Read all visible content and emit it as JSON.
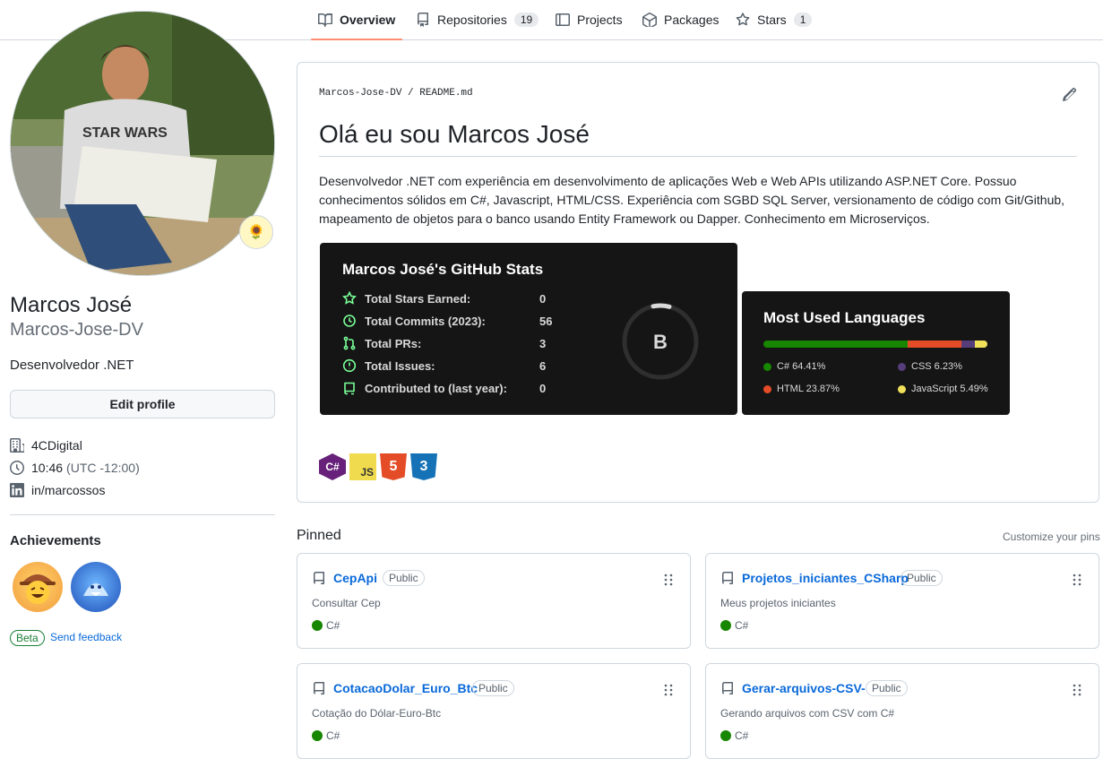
{
  "tabs": [
    {
      "label": "Overview",
      "count": ""
    },
    {
      "label": "Repositories",
      "count": "19"
    },
    {
      "label": "Projects",
      "count": ""
    },
    {
      "label": "Packages",
      "count": ""
    },
    {
      "label": "Stars",
      "count": "1"
    }
  ],
  "profile": {
    "status_emoji": "🌻",
    "fullname": "Marcos José",
    "login": "Marcos-Jose-DV",
    "bio": "Desenvolvedor .NET",
    "edit_label": "Edit profile",
    "company": "4CDigital",
    "time": "10:46",
    "timezone": "(UTC -12:00)",
    "linkedin": "in/marcossos"
  },
  "achievements": {
    "title": "Achievements",
    "beta": "Beta",
    "feedback": "Send feedback"
  },
  "readme": {
    "path": "Marcos-Jose-DV / README.md",
    "heading": "Olá eu sou Marcos José",
    "text": "Desenvolvedor .NET com experiência em desenvolvimento de aplicações Web e Web APIs utilizando ASP.NET Core. Possuo conhecimentos sólidos em C#, Javascript, HTML/CSS. Experiência com SGBD SQL Server, versionamento de código com Git/Github, mapeamento de objetos para o banco usando Entity Framework ou Dapper. Conhecimento em Microserviços.",
    "stats": {
      "title": "Marcos José's GitHub Stats",
      "rows": [
        {
          "label": "Total Stars Earned:",
          "value": "0"
        },
        {
          "label": "Total Commits (2023):",
          "value": "56"
        },
        {
          "label": "Total PRs:",
          "value": "3"
        },
        {
          "label": "Total Issues:",
          "value": "6"
        },
        {
          "label": "Contributed to (last year):",
          "value": "0"
        }
      ],
      "rank": "B"
    },
    "languages": {
      "title": "Most Used Languages",
      "items": [
        {
          "label": "C# 64.41%",
          "percent": 64.41,
          "color": "#178600"
        },
        {
          "label": "HTML 23.87%",
          "percent": 23.87,
          "color": "#e34c26"
        },
        {
          "label": "CSS 6.23%",
          "percent": 6.23,
          "color": "#563d7c"
        },
        {
          "label": "JavaScript 5.49%",
          "percent": 5.49,
          "color": "#f1e05a"
        }
      ]
    },
    "tech_icons": {
      "csharp": "C#",
      "js": "JS",
      "html": "5",
      "css": "3"
    }
  },
  "pinned": {
    "title": "Pinned",
    "customize": "Customize your pins",
    "repos": [
      {
        "name": "CepApi",
        "visibility": "Public",
        "description": "Consultar Cep",
        "language": "C#"
      },
      {
        "name": "Projetos_iniciantes_CSharp",
        "visibility": "Public",
        "description": "Meus projetos iniciantes",
        "language": "C#"
      },
      {
        "name": "CotacaoDolar_Euro_Btc",
        "visibility": "Public",
        "description": "Cotação do Dólar-Euro-Btc",
        "language": "C#"
      },
      {
        "name": "Gerar-arquivos-CSV-",
        "visibility": "Public",
        "description": "Gerando arquivos com CSV com C#",
        "language": "C#"
      }
    ]
  },
  "colors": {
    "accent": "#fd8c73",
    "link": "#0969da",
    "stat_icon": "#79ff97"
  }
}
